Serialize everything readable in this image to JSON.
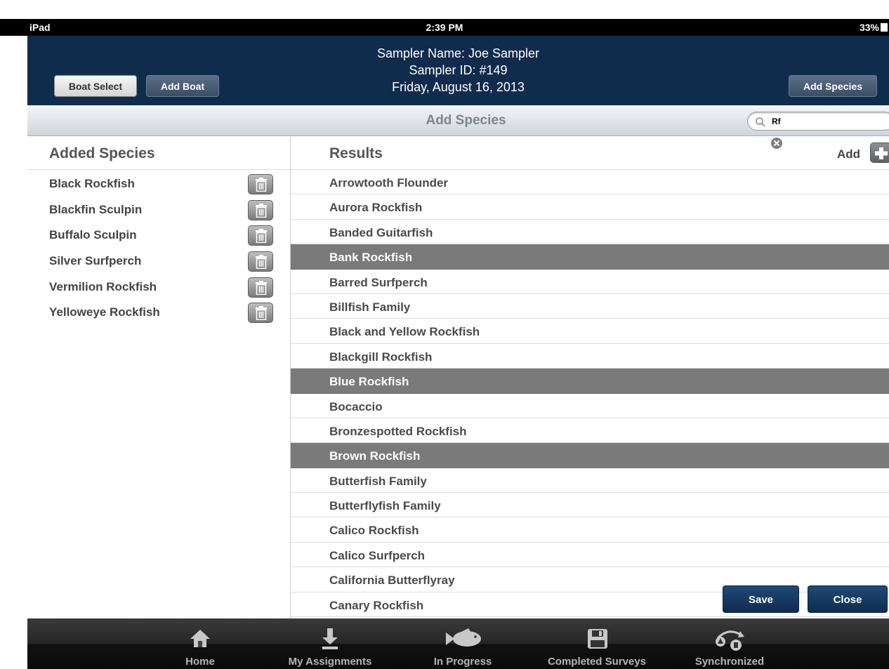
{
  "status_bar": {
    "device": "iPad",
    "time": "2:39 PM",
    "battery": "33%"
  },
  "header": {
    "sampler_name": "Sampler Name: Joe Sampler",
    "sampler_id": "Sampler ID: #149",
    "date": "Friday, August 16, 2013",
    "boat_select_label": "Boat Select",
    "add_boat_label": "Add Boat",
    "add_species_label": "Add Species"
  },
  "title_bar": {
    "title": "Add Species",
    "search_value": "Rf"
  },
  "added_species": {
    "heading": "Added Species",
    "items": [
      "Black Rockfish",
      "Blackfin Sculpin",
      "Buffalo Sculpin",
      "Silver Surfperch",
      "Vermilion Rockfish",
      "Yelloweye Rockfish"
    ]
  },
  "results": {
    "heading": "Results",
    "add_label": "Add",
    "items": [
      {
        "name": "Arrowtooth Flounder",
        "selected": false
      },
      {
        "name": "Aurora Rockfish",
        "selected": false
      },
      {
        "name": "Banded Guitarfish",
        "selected": false
      },
      {
        "name": "Bank Rockfish",
        "selected": true
      },
      {
        "name": "Barred Surfperch",
        "selected": false
      },
      {
        "name": "Billfish Family",
        "selected": false
      },
      {
        "name": "Black and Yellow Rockfish",
        "selected": false
      },
      {
        "name": "Blackgill Rockfish",
        "selected": false
      },
      {
        "name": "Blue Rockfish",
        "selected": true
      },
      {
        "name": "Bocaccio",
        "selected": false
      },
      {
        "name": "Bronzespotted Rockfish",
        "selected": false
      },
      {
        "name": "Brown Rockfish",
        "selected": true
      },
      {
        "name": "Butterfish Family",
        "selected": false
      },
      {
        "name": "Butterflyfish Family",
        "selected": false
      },
      {
        "name": "Calico Rockfish",
        "selected": false
      },
      {
        "name": "Calico Surfperch",
        "selected": false
      },
      {
        "name": "California Butterflyray",
        "selected": false
      },
      {
        "name": "Canary Rockfish",
        "selected": false
      }
    ]
  },
  "actions": {
    "save_label": "Save",
    "close_label": "Close"
  },
  "tab_bar": {
    "items": [
      {
        "label": "Home",
        "icon": "home-icon"
      },
      {
        "label": "My Assignments",
        "icon": "download-icon"
      },
      {
        "label": "In Progress",
        "icon": "fish-icon"
      },
      {
        "label": "Completed Surveys",
        "icon": "floppy-disk-icon"
      },
      {
        "label": "Synchronized",
        "icon": "sync-icon"
      }
    ]
  },
  "colors": {
    "header_bg": "#102c4c",
    "selected_row": "#7a7a7a",
    "action_button": "#173d66"
  }
}
